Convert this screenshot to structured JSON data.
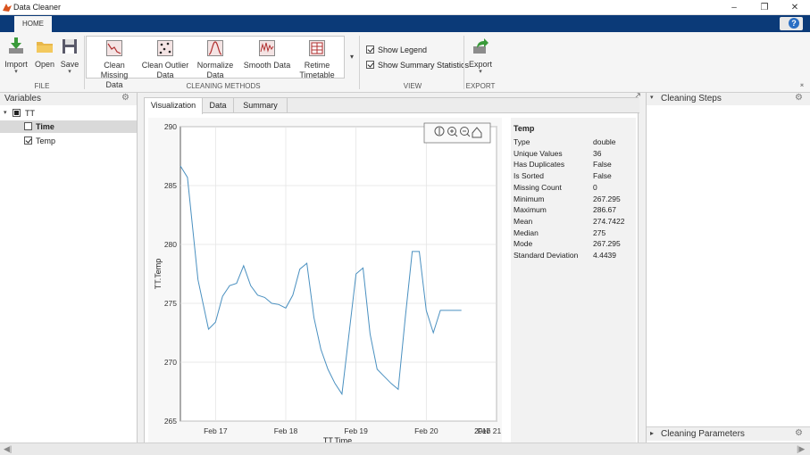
{
  "window": {
    "title": "Data Cleaner"
  },
  "ribbon": {
    "home_tab": "HOME",
    "file": {
      "label": "FILE",
      "import": "Import",
      "open": "Open",
      "save": "Save"
    },
    "cleaning": {
      "label": "CLEANING METHODS",
      "clean_missing": [
        "Clean",
        "Missing Data"
      ],
      "clean_outlier": [
        "Clean Outlier",
        "Data"
      ],
      "normalize": [
        "Normalize",
        "Data"
      ],
      "smooth": [
        "Smooth Data"
      ],
      "retime": [
        "Retime",
        "Timetable"
      ]
    },
    "view": {
      "label": "VIEW",
      "show_legend": "Show Legend",
      "show_summary": "Show Summary Statistics"
    },
    "export": {
      "label": "EXPORT",
      "button": "Export"
    }
  },
  "variables_panel": {
    "title": "Variables",
    "tree": [
      {
        "label": "TT",
        "state": "partial"
      },
      {
        "label": "Time",
        "state": "unchecked"
      },
      {
        "label": "Temp",
        "state": "checked"
      }
    ]
  },
  "document": {
    "tabs": [
      "Visualization",
      "Data",
      "Summary"
    ],
    "active_tab": "Visualization"
  },
  "chart_data": {
    "type": "line",
    "xlabel": "TT.Time",
    "ylabel": "TT.Temp",
    "ylim": [
      265,
      290
    ],
    "yticks": [
      265,
      270,
      275,
      280,
      285,
      290
    ],
    "xtick_labels": [
      "Feb 17",
      "Feb 18",
      "Feb 19",
      "Feb 20",
      "Feb 21"
    ],
    "x_secondary_label": "2017",
    "grid": true,
    "color": "#4a90c0",
    "x_days": [
      16.5,
      16.6,
      16.75,
      16.9,
      17.0,
      17.1,
      17.2,
      17.3,
      17.4,
      17.5,
      17.6,
      17.7,
      17.8,
      17.9,
      18.0,
      18.1,
      18.2,
      18.3,
      18.4,
      18.5,
      18.6,
      18.7,
      18.8,
      18.9,
      19.0,
      19.1,
      19.2,
      19.3,
      19.4,
      19.5,
      19.6,
      19.7,
      19.8,
      19.9,
      20.0,
      20.1,
      20.2,
      20.3,
      20.4,
      20.5,
      20.6
    ],
    "values": [
      286.67,
      285.7,
      277.0,
      272.8,
      273.4,
      275.6,
      276.5,
      276.7,
      278.2,
      276.5,
      275.7,
      275.5,
      275.0,
      274.9,
      274.6,
      275.7,
      277.9,
      278.4,
      273.8,
      271.1,
      269.4,
      268.2,
      267.295,
      272.4,
      277.5,
      278.0,
      272.4,
      269.4,
      268.8,
      268.2,
      267.7,
      273.7,
      279.4,
      279.4,
      274.4,
      272.5,
      274.4,
      274.4,
      274.4,
      274.4,
      274.4
    ]
  },
  "stats": {
    "title": "Temp",
    "rows": [
      [
        "Type",
        "double"
      ],
      [
        "Unique Values",
        "36"
      ],
      [
        "Has Duplicates",
        "False"
      ],
      [
        "Is Sorted",
        "False"
      ],
      [
        "Missing Count",
        "0"
      ],
      [
        "Minimum",
        "267.295"
      ],
      [
        "Maximum",
        "286.67"
      ],
      [
        "Mean",
        "274.7422"
      ],
      [
        "Median",
        "275"
      ],
      [
        "Mode",
        "267.295"
      ],
      [
        "Standard Deviation",
        "4.4439"
      ]
    ]
  },
  "right_panel": {
    "cleaning_steps": "Cleaning Steps",
    "cleaning_parameters": "Cleaning Parameters"
  }
}
